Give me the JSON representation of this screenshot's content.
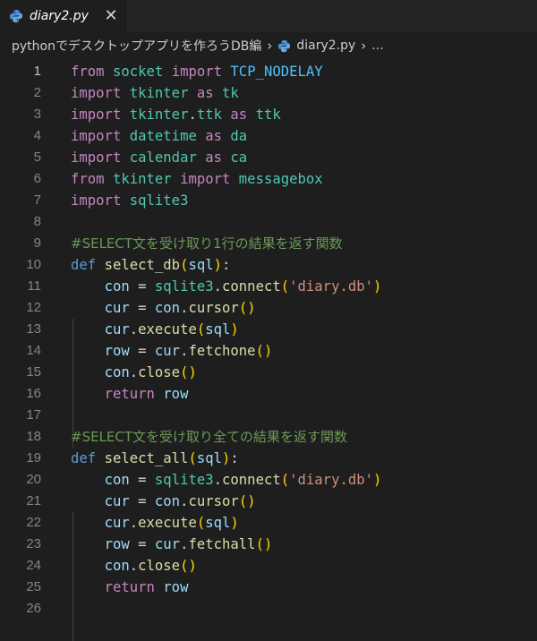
{
  "tab": {
    "label": "diary2.py",
    "close": "✕"
  },
  "breadcrumb": {
    "folder": "pythonでデスクトップアプリを作ろうDB編",
    "file": "diary2.py",
    "more": "...",
    "sep": "›"
  },
  "colors": {
    "editor_bg": "#1e1e1e",
    "keyword_import": "#c586c0",
    "keyword_def": "#569cd6",
    "module": "#4ec9b0",
    "variable": "#9cdcfe",
    "function": "#dcdcaa",
    "string": "#ce9178",
    "comment": "#6a9955"
  },
  "code_lines": [
    {
      "n": "1",
      "active": true,
      "tokens": [
        [
          "from",
          "kw-imp"
        ],
        [
          " "
        ],
        [
          "socket",
          "ident"
        ],
        [
          " "
        ],
        [
          "import",
          "kw-imp"
        ],
        [
          " "
        ],
        [
          "TCP_NODELAY",
          "const"
        ]
      ]
    },
    {
      "n": "2",
      "tokens": [
        [
          "import",
          "kw-imp"
        ],
        [
          " "
        ],
        [
          "tkinter",
          "ident"
        ],
        [
          " "
        ],
        [
          "as",
          "kw-imp"
        ],
        [
          " "
        ],
        [
          "tk",
          "ident"
        ]
      ]
    },
    {
      "n": "3",
      "tokens": [
        [
          "import",
          "kw-imp"
        ],
        [
          " "
        ],
        [
          "tkinter",
          "ident"
        ],
        [
          ".",
          "plain"
        ],
        [
          "ttk",
          "ident"
        ],
        [
          " "
        ],
        [
          "as",
          "kw-imp"
        ],
        [
          " "
        ],
        [
          "ttk",
          "ident"
        ]
      ]
    },
    {
      "n": "4",
      "tokens": [
        [
          "import",
          "kw-imp"
        ],
        [
          " "
        ],
        [
          "datetime",
          "ident"
        ],
        [
          " "
        ],
        [
          "as",
          "kw-imp"
        ],
        [
          " "
        ],
        [
          "da",
          "ident"
        ]
      ]
    },
    {
      "n": "5",
      "tokens": [
        [
          "import",
          "kw-imp"
        ],
        [
          " "
        ],
        [
          "calendar",
          "ident"
        ],
        [
          " "
        ],
        [
          "as",
          "kw-imp"
        ],
        [
          " "
        ],
        [
          "ca",
          "ident"
        ]
      ]
    },
    {
      "n": "6",
      "tokens": [
        [
          "from",
          "kw-imp"
        ],
        [
          " "
        ],
        [
          "tkinter",
          "ident"
        ],
        [
          " "
        ],
        [
          "import",
          "kw-imp"
        ],
        [
          " "
        ],
        [
          "messagebox",
          "ident"
        ]
      ]
    },
    {
      "n": "7",
      "tokens": [
        [
          "import",
          "kw-imp"
        ],
        [
          " "
        ],
        [
          "sqlite3",
          "ident"
        ]
      ]
    },
    {
      "n": "8",
      "tokens": []
    },
    {
      "n": "9",
      "tokens": [
        [
          "#SELECT文を受け取り1行の結果を返す関数",
          "cmt"
        ]
      ]
    },
    {
      "n": "10",
      "tokens": [
        [
          "def",
          "kw-def"
        ],
        [
          " "
        ],
        [
          "select_db",
          "func"
        ],
        [
          "(",
          "p1"
        ],
        [
          "sql",
          "var"
        ],
        [
          ")",
          "p1"
        ],
        [
          ":",
          "plain"
        ]
      ]
    },
    {
      "n": "11",
      "tokens": [
        [
          "    "
        ],
        [
          "con",
          "var"
        ],
        [
          " = ",
          "plain"
        ],
        [
          "sqlite3",
          "ident"
        ],
        [
          ".",
          "plain"
        ],
        [
          "connect",
          "func"
        ],
        [
          "(",
          "p1"
        ],
        [
          "'diary.db'",
          "str"
        ],
        [
          ")",
          "p1"
        ]
      ]
    },
    {
      "n": "12",
      "tokens": [
        [
          "    "
        ],
        [
          "cur",
          "var"
        ],
        [
          " = ",
          "plain"
        ],
        [
          "con",
          "var"
        ],
        [
          ".",
          "plain"
        ],
        [
          "cursor",
          "func"
        ],
        [
          "()",
          "p1"
        ]
      ]
    },
    {
      "n": "13",
      "tokens": [
        [
          "    "
        ],
        [
          "cur",
          "var"
        ],
        [
          ".",
          "plain"
        ],
        [
          "execute",
          "func"
        ],
        [
          "(",
          "p1"
        ],
        [
          "sql",
          "var"
        ],
        [
          ")",
          "p1"
        ]
      ]
    },
    {
      "n": "14",
      "tokens": [
        [
          "    "
        ],
        [
          "row",
          "var"
        ],
        [
          " = ",
          "plain"
        ],
        [
          "cur",
          "var"
        ],
        [
          ".",
          "plain"
        ],
        [
          "fetchone",
          "func"
        ],
        [
          "()",
          "p1"
        ]
      ]
    },
    {
      "n": "15",
      "tokens": [
        [
          "    "
        ],
        [
          "con",
          "var"
        ],
        [
          ".",
          "plain"
        ],
        [
          "close",
          "func"
        ],
        [
          "()",
          "p1"
        ]
      ]
    },
    {
      "n": "16",
      "tokens": [
        [
          "    "
        ],
        [
          "return",
          "kw-imp"
        ],
        [
          " "
        ],
        [
          "row",
          "var"
        ]
      ]
    },
    {
      "n": "17",
      "tokens": []
    },
    {
      "n": "18",
      "tokens": [
        [
          "#SELECT文を受け取り全ての結果を返す関数",
          "cmt"
        ]
      ]
    },
    {
      "n": "19",
      "tokens": [
        [
          "def",
          "kw-def"
        ],
        [
          " "
        ],
        [
          "select_all",
          "func"
        ],
        [
          "(",
          "p1"
        ],
        [
          "sql",
          "var"
        ],
        [
          ")",
          "p1"
        ],
        [
          ":",
          "plain"
        ]
      ]
    },
    {
      "n": "20",
      "tokens": [
        [
          "    "
        ],
        [
          "con",
          "var"
        ],
        [
          " = ",
          "plain"
        ],
        [
          "sqlite3",
          "ident"
        ],
        [
          ".",
          "plain"
        ],
        [
          "connect",
          "func"
        ],
        [
          "(",
          "p1"
        ],
        [
          "'diary.db'",
          "str"
        ],
        [
          ")",
          "p1"
        ]
      ]
    },
    {
      "n": "21",
      "tokens": [
        [
          "    "
        ],
        [
          "cur",
          "var"
        ],
        [
          " = ",
          "plain"
        ],
        [
          "con",
          "var"
        ],
        [
          ".",
          "plain"
        ],
        [
          "cursor",
          "func"
        ],
        [
          "()",
          "p1"
        ]
      ]
    },
    {
      "n": "22",
      "tokens": [
        [
          "    "
        ],
        [
          "cur",
          "var"
        ],
        [
          ".",
          "plain"
        ],
        [
          "execute",
          "func"
        ],
        [
          "(",
          "p1"
        ],
        [
          "sql",
          "var"
        ],
        [
          ")",
          "p1"
        ]
      ]
    },
    {
      "n": "23",
      "tokens": [
        [
          "    "
        ],
        [
          "row",
          "var"
        ],
        [
          " = ",
          "plain"
        ],
        [
          "cur",
          "var"
        ],
        [
          ".",
          "plain"
        ],
        [
          "fetchall",
          "func"
        ],
        [
          "()",
          "p1"
        ]
      ]
    },
    {
      "n": "24",
      "tokens": [
        [
          "    "
        ],
        [
          "con",
          "var"
        ],
        [
          ".",
          "plain"
        ],
        [
          "close",
          "func"
        ],
        [
          "()",
          "p1"
        ]
      ]
    },
    {
      "n": "25",
      "tokens": [
        [
          "    "
        ],
        [
          "return",
          "kw-imp"
        ],
        [
          " "
        ],
        [
          "row",
          "var"
        ]
      ]
    },
    {
      "n": "26",
      "tokens": []
    }
  ]
}
